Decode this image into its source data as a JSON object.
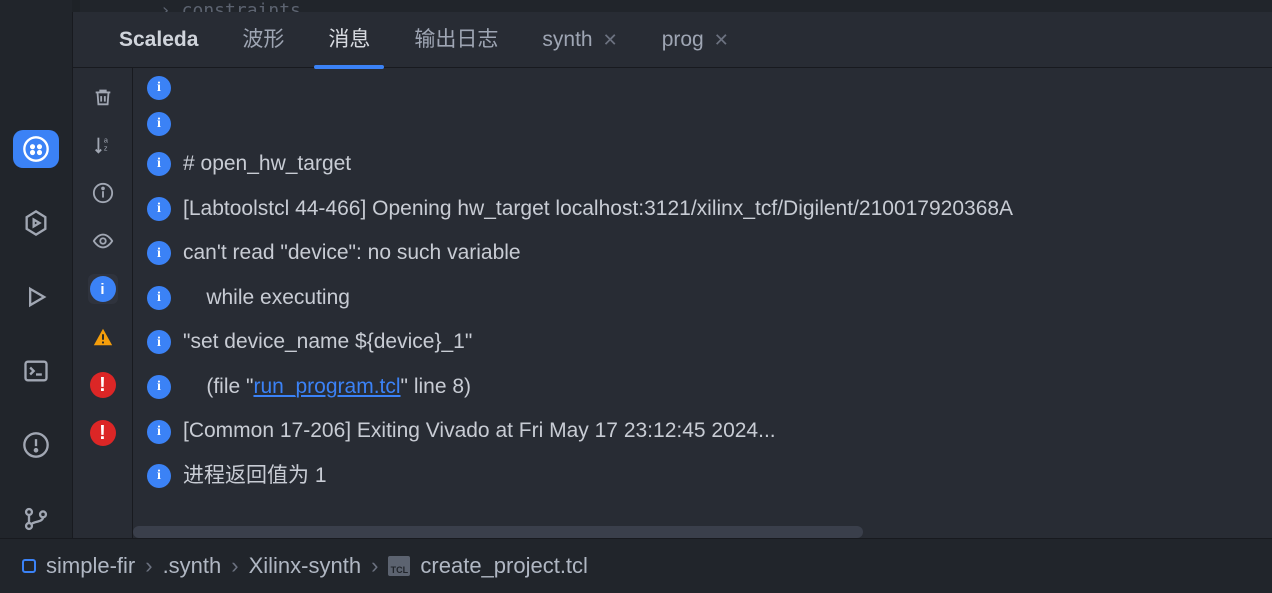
{
  "top_hint": "› constraints",
  "tabs": {
    "scaleda": "Scaleda",
    "wave": "波形",
    "messages": "消息",
    "output": "输出日志",
    "synth": "synth",
    "prog": "prog"
  },
  "messages": [
    {
      "t": ""
    },
    {
      "t": ""
    },
    {
      "t": "# open_hw_target"
    },
    {
      "t": "[Labtoolstcl 44-466] Opening hw_target localhost:3121/xilinx_tcf/Digilent/210017920368A"
    },
    {
      "t": "can't read \"device\": no such variable"
    },
    {
      "t": "    while executing"
    },
    {
      "t": "\"set device_name ${device}_1\""
    },
    {
      "pre": "    (file \"",
      "link": "run_program.tcl",
      "post": "\" line 8)"
    },
    {
      "t": "[Common 17-206] Exiting Vivado at Fri May 17 23:12:45 2024..."
    },
    {
      "t": "进程返回值为 1"
    }
  ],
  "breadcrumbs": {
    "project": "simple-fir",
    "dir": ".synth",
    "sub": "Xilinx-synth",
    "file": "create_project.tcl"
  }
}
